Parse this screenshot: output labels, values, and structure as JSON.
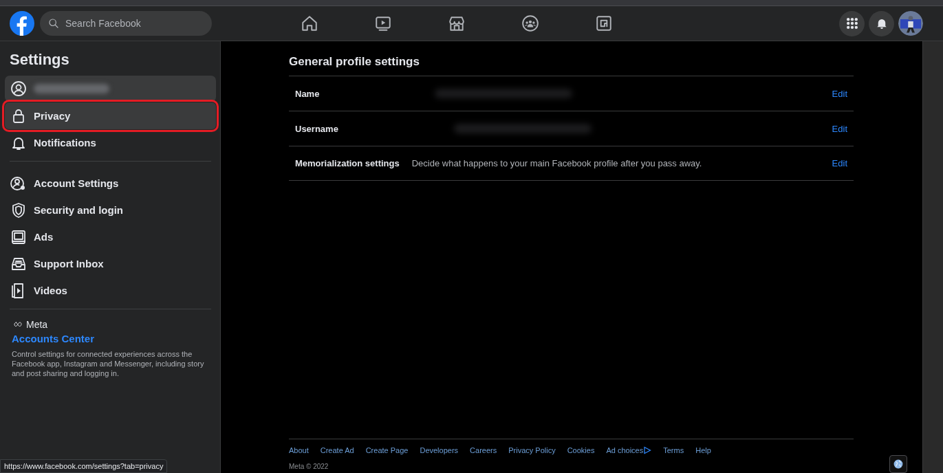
{
  "topbar": {
    "search": {
      "placeholder": "Search Facebook"
    },
    "nav": [
      {
        "kind": "home",
        "selected": false
      },
      {
        "kind": "video",
        "selected": false
      },
      {
        "kind": "store",
        "selected": false
      },
      {
        "kind": "groups",
        "selected": false
      },
      {
        "kind": "gaming",
        "selected": false
      }
    ]
  },
  "sidebar": {
    "title": "Settings",
    "items": [
      {
        "kind": "profile",
        "outlined": false
      },
      {
        "kind": "lock",
        "label": "Privacy",
        "selected": true,
        "outlined": true
      },
      {
        "kind": "bell",
        "label": "Notifications",
        "selected": false,
        "outlined": false
      },
      {
        "kind": "divider"
      },
      {
        "kind": "account",
        "label": "Account Settings",
        "selected": false,
        "outlined": false
      },
      {
        "kind": "shield",
        "label": "Security and login",
        "selected": false,
        "outlined": false
      },
      {
        "kind": "ads",
        "label": "Ads",
        "selected": false,
        "outlined": false
      },
      {
        "kind": "inbox",
        "label": "Support Inbox",
        "selected": false,
        "outlined": false
      },
      {
        "kind": "videos",
        "label": "Videos",
        "selected": false,
        "outlined": false
      }
    ],
    "meta": {
      "brand": "Meta",
      "link": "Accounts Center",
      "description": "Control settings for connected experiences across the Facebook app, Instagram and Messenger, including story and post sharing and logging in."
    }
  },
  "main": {
    "title": "General profile settings",
    "rows": [
      {
        "label": "Name",
        "redacted": true,
        "action": "Edit"
      },
      {
        "label": "Username",
        "redacted": true,
        "action": "Edit"
      },
      {
        "label": "Memorialization settings",
        "value": "Decide what happens to your main Facebook profile after you pass away.",
        "action": "Edit"
      }
    ],
    "footer": {
      "links": [
        "About",
        "Create Ad",
        "Create Page",
        "Developers",
        "Careers",
        "Privacy Policy",
        "Cookies",
        "Ad choices",
        "Terms",
        "Help"
      ],
      "copyright": "Meta © 2022"
    }
  },
  "status_bar": {
    "url": "https://www.facebook.com/settings?tab=privacy"
  }
}
